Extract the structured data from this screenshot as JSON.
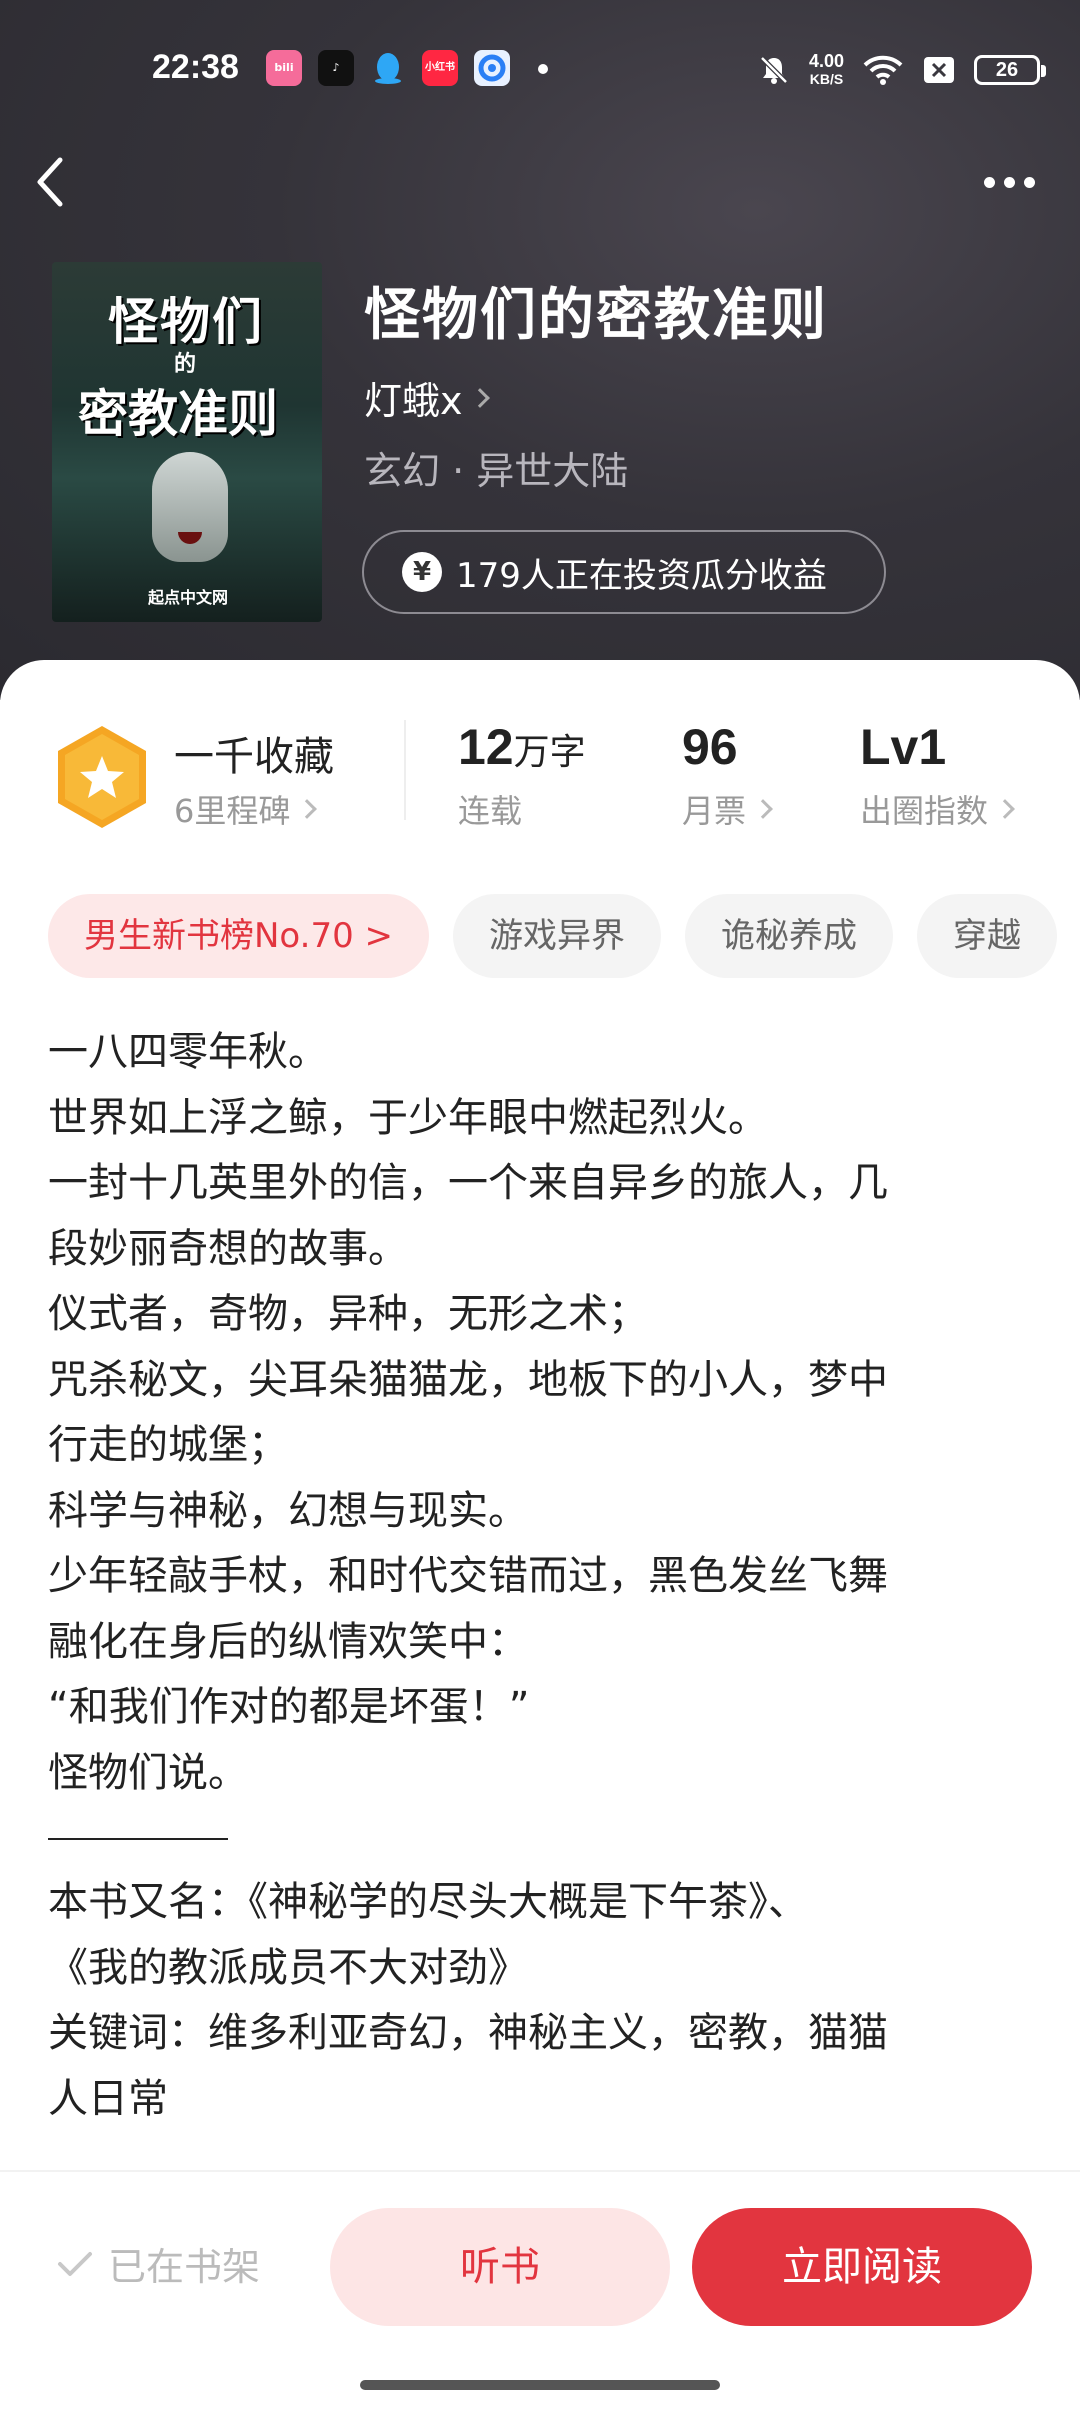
{
  "status_bar": {
    "time": "22:38",
    "app_icons": [
      "bilibili-icon",
      "tiktok-icon",
      "qq-icon",
      "xiaohongshu-icon",
      "browser-icon"
    ],
    "net_speed_value": "4.00",
    "net_speed_unit": "KB/S",
    "battery": "26"
  },
  "book": {
    "title": "怪物们的密教准则",
    "author": "灯蛾x",
    "genre": "玄幻 · 异世大陆",
    "invest_text": "179人正在投资瓜分收益",
    "cover": {
      "title_line1": "怪物们",
      "title_line2": "的",
      "title_line3": "密教准则",
      "publisher": "起点中文网"
    }
  },
  "stats": {
    "collection_title": "一千收藏",
    "collection_sub": "6里程碑",
    "words_value": "12",
    "words_unit": "万字",
    "words_label": "连载",
    "monthly_value": "96",
    "monthly_label": "月票",
    "level_value": "Lv1",
    "level_label": "出圈指数"
  },
  "tags": [
    "男生新书榜No.70 >",
    "游戏异界",
    "诡秘养成",
    "穿越"
  ],
  "synopsis": [
    "一八四零年秋。",
    "世界如上浮之鲸，于少年眼中燃起烈火。",
    "一封十几英里外的信，一个来自异乡的旅人，几",
    "段妙丽奇想的故事。",
    "仪式者，奇物，异种，无形之术；",
    "咒杀秘文，尖耳朵猫猫龙，地板下的小人，梦中",
    "行走的城堡；",
    "科学与神秘，幻想与现实。",
    "少年轻敲手杖，和时代交错而过，黑色发丝飞舞",
    "融化在身后的纵情欢笑中：",
    "“和我们作对的都是坏蛋！”",
    "怪物们说。"
  ],
  "synopsis_extra": [
    "本书又名：《神秘学的尽头大概是下午茶》、",
    "《我的教派成员不大对劲》",
    "关键词：维多利亚奇幻，神秘主义，密教，猫猫",
    "人日常"
  ],
  "actions": {
    "shelf": "已在书架",
    "listen": "听书",
    "read": "立即阅读"
  },
  "colors": {
    "accent": "#e2353f",
    "accent_light": "#fde5e5",
    "badge": "#f5a623"
  }
}
